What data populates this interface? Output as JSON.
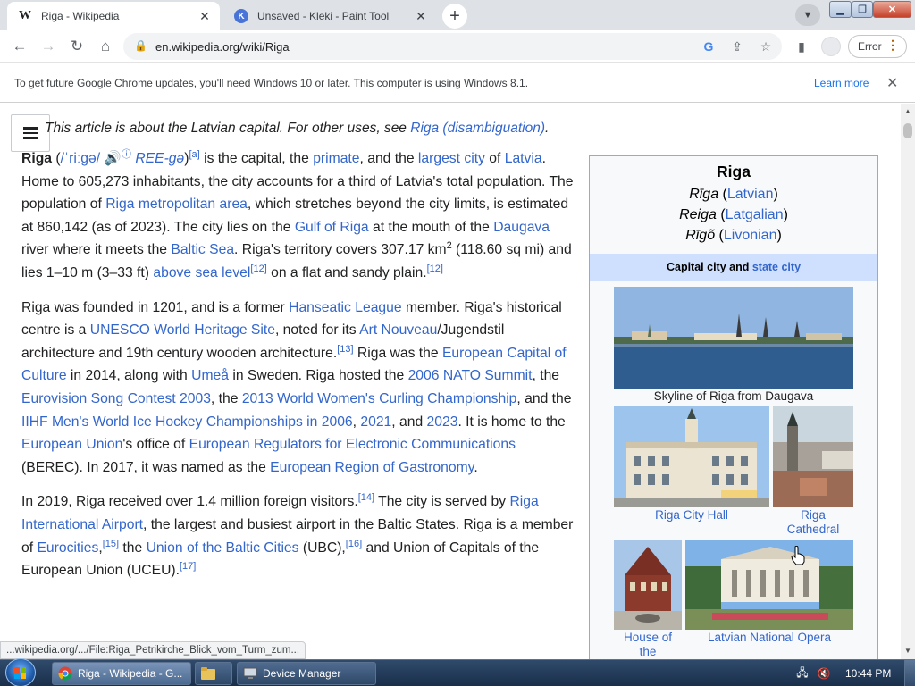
{
  "browser": {
    "tabs": [
      {
        "title": "Riga - Wikipedia",
        "favicon": "W",
        "active": true
      },
      {
        "title": "Unsaved - Kleki - Paint Tool",
        "favicon": "K",
        "active": false
      }
    ],
    "new_tab_label": "+",
    "url": "en.wikipedia.org/wiki/Riga",
    "profile_button": "Error"
  },
  "infobar": {
    "message": "To get future Google Chrome updates, you'll need Windows 10 or later. This computer is using Windows 8.1.",
    "link": "Learn more",
    "close": "✕"
  },
  "article": {
    "hatnote_prefix": "This article is about the Latvian capital. For other uses, see ",
    "hatnote_link": "Riga (disambiguation)",
    "hatnote_suffix": ".",
    "p1": {
      "bold": "Riga",
      "t1": " (",
      "ipa": "/ˈriːɡə/",
      "speaker": "🔊",
      "info": "ⓘ",
      "respell": "REE-gə",
      "t2": ")",
      "sup_a": "[a]",
      "t3": " is the capital, the ",
      "l_primate": "primate",
      "t4": ", and the ",
      "l_largest": "largest city",
      "t5": " of ",
      "l_latvia": "Latvia",
      "t6": ". Home to 605,273 inhabitants, the city accounts for a third of Latvia's total population. The population of ",
      "l_metro": "Riga metropolitan area",
      "t7": ", which stretches beyond the city limits, is estimated at 860,142 (as of 2023). The city lies on the ",
      "l_gulf": "Gulf of Riga",
      "t8": " at the mouth of the ",
      "l_daugava": "Daugava",
      "t9": " river where it meets the ",
      "l_baltic": "Baltic Sea",
      "t10": ". Riga's territory covers 307.17 km",
      "sup2": "2",
      "t11": " (118.60 sq mi) and lies 1–10 m (3–33 ft) ",
      "l_asl": "above sea level",
      "sup12a": "[12]",
      "t12": " on a flat and sandy plain.",
      "sup12b": "[12]"
    },
    "p2": {
      "t1": "Riga was founded in 1201, and is a former ",
      "l_hanseatic": "Hanseatic League",
      "t2": " member. Riga's historical centre is a ",
      "l_unesco": "UNESCO World Heritage Site",
      "t3": ", noted for its ",
      "l_artnouveau": "Art Nouveau",
      "t4": "/Jugendstil architecture and 19th century wooden architecture.",
      "sup13": "[13]",
      "t5": " Riga was the ",
      "l_ecoc": "European Capital of Culture",
      "t6": " in 2014, along with ",
      "l_umea": "Umeå",
      "t7": " in Sweden. Riga hosted the ",
      "l_nato": "2006 NATO Summit",
      "t8": ", the ",
      "l_eurovision": "Eurovision Song Contest 2003",
      "t9": ", the ",
      "l_curling": "2013 World Women's Curling Championship",
      "t10": ", and the ",
      "l_iihf": "IIHF Men's World Ice Hockey Championships in 2006",
      "t11": ", ",
      "l_2021": "2021",
      "t12": ", and ",
      "l_2023": "2023",
      "t13": ". It is home to the ",
      "l_eu": "European Union",
      "t14": "'s office of ",
      "l_berec": "European Regulators for Electronic Communications",
      "t15": " (BEREC). In 2017, it was named as the ",
      "l_gastro": "European Region of Gastronomy",
      "t16": "."
    },
    "p3": {
      "t1": "In 2019, Riga received over 1.4 million foreign visitors.",
      "sup14": "[14]",
      "t2": " The city is served by ",
      "l_airport": "Riga International Airport",
      "t3": ", the largest and busiest airport in the Baltic States. Riga is a member of ",
      "l_eurocities": "Eurocities",
      "t4": ",",
      "sup15": "[15]",
      "t5": " the ",
      "l_ubc": "Union of the Baltic Cities",
      "t6": " (UBC),",
      "sup16": "[16]",
      "t7": " and Union of Capitals of the European Union (UCEU).",
      "sup17": "[17]"
    }
  },
  "infobox": {
    "title": "Riga",
    "names": [
      {
        "native": "Rīga",
        "lang": "Latvian"
      },
      {
        "native": "Reiga",
        "lang": "Latgalian"
      },
      {
        "native": "Rīgõ",
        "lang": "Livonian"
      }
    ],
    "header_text": "Capital city and ",
    "header_link": "state city",
    "captions": {
      "skyline": "Skyline of Riga from Daugava",
      "cityhall": "Riga City Hall",
      "cathedral": "Riga Cathedral",
      "blackheads": "House of the",
      "opera": "Latvian National Opera"
    }
  },
  "status_url": "...wikipedia.org/.../File:Riga_Petrikirche_Blick_vom_Turm_zum...",
  "taskbar": {
    "items": [
      {
        "label": "Riga - Wikipedia - G...",
        "icon": "chrome-icon",
        "active": true
      },
      {
        "label": "",
        "icon": "folder-icon",
        "active": false
      },
      {
        "label": "Device Manager",
        "icon": "device-manager-icon",
        "active": false
      }
    ],
    "clock": "10:44 PM"
  }
}
